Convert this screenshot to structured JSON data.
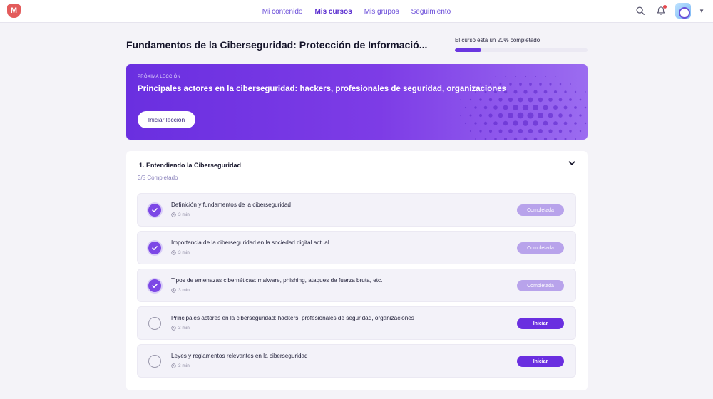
{
  "nav": {
    "logo": "M",
    "items": [
      {
        "label": "Mi contenido",
        "active": false
      },
      {
        "label": "Mis cursos",
        "active": true
      },
      {
        "label": "Mis grupos",
        "active": false
      },
      {
        "label": "Seguimiento",
        "active": false
      }
    ],
    "icons": [
      "search-icon",
      "bell-icon",
      "avatar",
      "chevron-down-icon"
    ]
  },
  "course": {
    "title": "Fundamentos de la Ciberseguridad: Protección de Informació...",
    "progress_label": "El curso está un 20% completado",
    "progress_percent": 20
  },
  "banner": {
    "kicker": "Próxima lección",
    "title": "Principales actores en la ciberseguridad: hackers, profesionales de seguridad, organizaciones",
    "button": "Iniciar lección"
  },
  "module": {
    "title": "1. Entendiendo la Ciberseguridad",
    "subtitle": "3/5 Completado",
    "lessons": [
      {
        "title": "Definición y fundamentos de la ciberseguridad",
        "duration": "3 min",
        "status": "done",
        "button": "Completada"
      },
      {
        "title": "Importancia de la ciberseguridad en la sociedad digital actual",
        "duration": "3 min",
        "status": "done",
        "button": "Completada"
      },
      {
        "title": "Tipos de amenazas cibernéticas: malware, phishing, ataques de fuerza bruta, etc.",
        "duration": "3 min",
        "status": "done",
        "button": "Completada"
      },
      {
        "title": "Principales actores en la ciberseguridad: hackers, profesionales de seguridad, organizaciones",
        "duration": "3 min",
        "status": "todo",
        "button": "Iniciar"
      },
      {
        "title": "Leyes y reglamentos relevantes en la ciberseguridad",
        "duration": "3 min",
        "status": "todo",
        "button": "Iniciar"
      }
    ]
  },
  "colors": {
    "accent": "#6a2fe0",
    "done_button": "#b8a3eb",
    "logo": "#e35b5b"
  }
}
